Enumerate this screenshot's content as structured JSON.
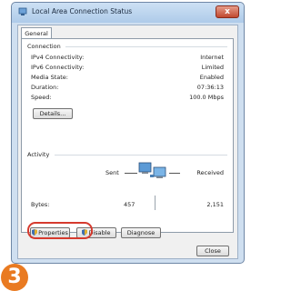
{
  "window": {
    "title": "Local Area Connection Status",
    "close_label": "x"
  },
  "tabs": [
    {
      "label": "General"
    }
  ],
  "connection": {
    "group_label": "Connection",
    "rows": [
      {
        "label": "IPv4 Connectivity:",
        "value": "Internet"
      },
      {
        "label": "IPv6 Connectivity:",
        "value": "Limited"
      },
      {
        "label": "Media State:",
        "value": "Enabled"
      },
      {
        "label": "Duration:",
        "value": "07:36:13"
      },
      {
        "label": "Speed:",
        "value": "100.0 Mbps"
      }
    ],
    "details_label": "Details..."
  },
  "activity": {
    "group_label": "Activity",
    "sent_label": "Sent",
    "received_label": "Received",
    "bytes_label": "Bytes:",
    "bytes_sent": "457",
    "bytes_received": "2,151"
  },
  "buttons": {
    "properties": "Properties",
    "disable": "Disable",
    "diagnose": "Diagnose",
    "close": "Close"
  },
  "step_badge": "3",
  "colors": {
    "highlight": "#d63a2e",
    "badge": "#e97a21"
  }
}
